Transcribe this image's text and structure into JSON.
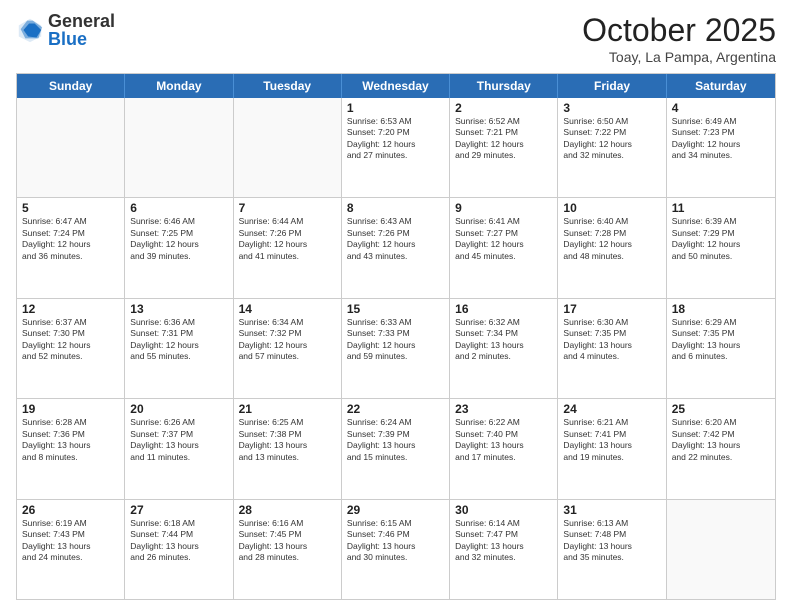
{
  "header": {
    "logo_general": "General",
    "logo_blue": "Blue",
    "month_title": "October 2025",
    "subtitle": "Toay, La Pampa, Argentina"
  },
  "day_headers": [
    "Sunday",
    "Monday",
    "Tuesday",
    "Wednesday",
    "Thursday",
    "Friday",
    "Saturday"
  ],
  "weeks": [
    [
      {
        "day": "",
        "info": ""
      },
      {
        "day": "",
        "info": ""
      },
      {
        "day": "",
        "info": ""
      },
      {
        "day": "1",
        "info": "Sunrise: 6:53 AM\nSunset: 7:20 PM\nDaylight: 12 hours\nand 27 minutes."
      },
      {
        "day": "2",
        "info": "Sunrise: 6:52 AM\nSunset: 7:21 PM\nDaylight: 12 hours\nand 29 minutes."
      },
      {
        "day": "3",
        "info": "Sunrise: 6:50 AM\nSunset: 7:22 PM\nDaylight: 12 hours\nand 32 minutes."
      },
      {
        "day": "4",
        "info": "Sunrise: 6:49 AM\nSunset: 7:23 PM\nDaylight: 12 hours\nand 34 minutes."
      }
    ],
    [
      {
        "day": "5",
        "info": "Sunrise: 6:47 AM\nSunset: 7:24 PM\nDaylight: 12 hours\nand 36 minutes."
      },
      {
        "day": "6",
        "info": "Sunrise: 6:46 AM\nSunset: 7:25 PM\nDaylight: 12 hours\nand 39 minutes."
      },
      {
        "day": "7",
        "info": "Sunrise: 6:44 AM\nSunset: 7:26 PM\nDaylight: 12 hours\nand 41 minutes."
      },
      {
        "day": "8",
        "info": "Sunrise: 6:43 AM\nSunset: 7:26 PM\nDaylight: 12 hours\nand 43 minutes."
      },
      {
        "day": "9",
        "info": "Sunrise: 6:41 AM\nSunset: 7:27 PM\nDaylight: 12 hours\nand 45 minutes."
      },
      {
        "day": "10",
        "info": "Sunrise: 6:40 AM\nSunset: 7:28 PM\nDaylight: 12 hours\nand 48 minutes."
      },
      {
        "day": "11",
        "info": "Sunrise: 6:39 AM\nSunset: 7:29 PM\nDaylight: 12 hours\nand 50 minutes."
      }
    ],
    [
      {
        "day": "12",
        "info": "Sunrise: 6:37 AM\nSunset: 7:30 PM\nDaylight: 12 hours\nand 52 minutes."
      },
      {
        "day": "13",
        "info": "Sunrise: 6:36 AM\nSunset: 7:31 PM\nDaylight: 12 hours\nand 55 minutes."
      },
      {
        "day": "14",
        "info": "Sunrise: 6:34 AM\nSunset: 7:32 PM\nDaylight: 12 hours\nand 57 minutes."
      },
      {
        "day": "15",
        "info": "Sunrise: 6:33 AM\nSunset: 7:33 PM\nDaylight: 12 hours\nand 59 minutes."
      },
      {
        "day": "16",
        "info": "Sunrise: 6:32 AM\nSunset: 7:34 PM\nDaylight: 13 hours\nand 2 minutes."
      },
      {
        "day": "17",
        "info": "Sunrise: 6:30 AM\nSunset: 7:35 PM\nDaylight: 13 hours\nand 4 minutes."
      },
      {
        "day": "18",
        "info": "Sunrise: 6:29 AM\nSunset: 7:35 PM\nDaylight: 13 hours\nand 6 minutes."
      }
    ],
    [
      {
        "day": "19",
        "info": "Sunrise: 6:28 AM\nSunset: 7:36 PM\nDaylight: 13 hours\nand 8 minutes."
      },
      {
        "day": "20",
        "info": "Sunrise: 6:26 AM\nSunset: 7:37 PM\nDaylight: 13 hours\nand 11 minutes."
      },
      {
        "day": "21",
        "info": "Sunrise: 6:25 AM\nSunset: 7:38 PM\nDaylight: 13 hours\nand 13 minutes."
      },
      {
        "day": "22",
        "info": "Sunrise: 6:24 AM\nSunset: 7:39 PM\nDaylight: 13 hours\nand 15 minutes."
      },
      {
        "day": "23",
        "info": "Sunrise: 6:22 AM\nSunset: 7:40 PM\nDaylight: 13 hours\nand 17 minutes."
      },
      {
        "day": "24",
        "info": "Sunrise: 6:21 AM\nSunset: 7:41 PM\nDaylight: 13 hours\nand 19 minutes."
      },
      {
        "day": "25",
        "info": "Sunrise: 6:20 AM\nSunset: 7:42 PM\nDaylight: 13 hours\nand 22 minutes."
      }
    ],
    [
      {
        "day": "26",
        "info": "Sunrise: 6:19 AM\nSunset: 7:43 PM\nDaylight: 13 hours\nand 24 minutes."
      },
      {
        "day": "27",
        "info": "Sunrise: 6:18 AM\nSunset: 7:44 PM\nDaylight: 13 hours\nand 26 minutes."
      },
      {
        "day": "28",
        "info": "Sunrise: 6:16 AM\nSunset: 7:45 PM\nDaylight: 13 hours\nand 28 minutes."
      },
      {
        "day": "29",
        "info": "Sunrise: 6:15 AM\nSunset: 7:46 PM\nDaylight: 13 hours\nand 30 minutes."
      },
      {
        "day": "30",
        "info": "Sunrise: 6:14 AM\nSunset: 7:47 PM\nDaylight: 13 hours\nand 32 minutes."
      },
      {
        "day": "31",
        "info": "Sunrise: 6:13 AM\nSunset: 7:48 PM\nDaylight: 13 hours\nand 35 minutes."
      },
      {
        "day": "",
        "info": ""
      }
    ]
  ]
}
